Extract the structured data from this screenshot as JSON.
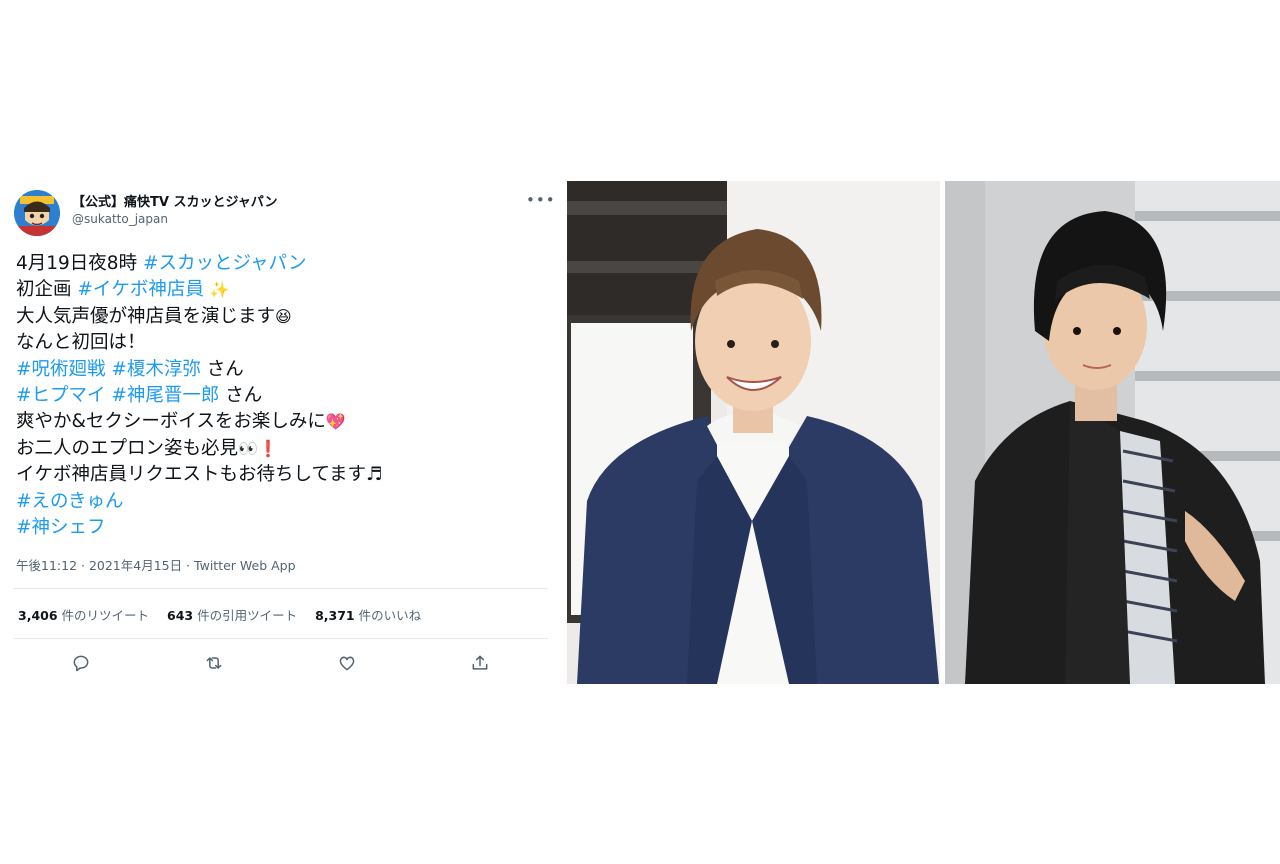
{
  "tweet": {
    "display_name": "【公式】痛快TV スカッとジャパン",
    "handle": "@sukatto_japan",
    "more_label": "•••",
    "lines": [
      {
        "pre": "4月19日夜8時 ",
        "tag": "#スカッとジャパン",
        "post": "",
        "emoji": ""
      },
      {
        "pre": "初企画 ",
        "tag": "#イケボ神店員",
        "post": " ",
        "emoji": "✨"
      },
      {
        "pre": "大人気声優が神店員を演じます",
        "tag": "",
        "post": "",
        "emoji": "😆"
      },
      {
        "pre": "なんと初回は！",
        "tag": "",
        "post": "",
        "emoji": ""
      },
      {
        "pre": "",
        "tag": "#呪術廻戦 #榎木淳弥",
        "post": " さん",
        "emoji": ""
      },
      {
        "pre": "",
        "tag": "#ヒプマイ #神尾晋一郎",
        "post": " さん",
        "emoji": ""
      },
      {
        "pre": "爽やか&セクシーボイスをお楽しみに",
        "tag": "",
        "post": "",
        "emoji": "💖"
      },
      {
        "pre": "お二人のエプロン姿も必見",
        "tag": "",
        "post": "",
        "emoji": "👀❗"
      },
      {
        "pre": "イケボ神店員リクエストもお待ちしてます♬",
        "tag": "",
        "post": "",
        "emoji": ""
      },
      {
        "pre": "",
        "tag": "#えのきゅん",
        "post": "",
        "emoji": ""
      },
      {
        "pre": "",
        "tag": "#神シェフ",
        "post": "",
        "emoji": ""
      }
    ],
    "meta": "午後11:12 · 2021年4月15日 · Twitter Web App",
    "stats": [
      {
        "num": "3,406",
        "label": " 件のリツイート"
      },
      {
        "num": "643",
        "label": " 件の引用ツイート"
      },
      {
        "num": "8,371",
        "label": " 件のいいね"
      }
    ],
    "actions": [
      "reply-icon",
      "retweet-icon",
      "like-icon",
      "share-icon"
    ]
  },
  "colors": {
    "link": "#1d9bf0",
    "text": "#0f1419",
    "muted": "#536471",
    "divider": "#e7e9ea",
    "jacket_navy": "#2b3b63",
    "jacket_black": "#1e1e1e"
  }
}
